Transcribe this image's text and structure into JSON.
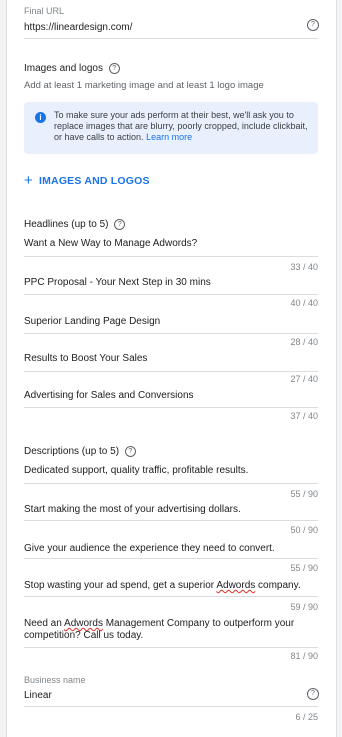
{
  "final_url": {
    "label": "Final URL",
    "value": "https://lineardesign.com/",
    "help": "?"
  },
  "images": {
    "title": "Images and logos",
    "help": "?",
    "subtitle": "Add at least 1 marketing image and at least 1 logo image",
    "info_icon": "i",
    "info_text": "To make sure your ads perform at their best, we'll ask you to replace images that are blurry, poorly cropped, include clickbait, or have calls to action. ",
    "info_link": "Learn more",
    "add_icon": "+",
    "add_label": "IMAGES AND LOGOS"
  },
  "headlines": {
    "title": "Headlines (up to 5)",
    "help": "?",
    "items": [
      {
        "text": "Want a New Way to Manage Adwords?",
        "counter": "33 / 40"
      },
      {
        "text": "PPC Proposal - Your Next Step in 30 mins",
        "counter": "40 / 40"
      },
      {
        "text": "Superior Landing Page Design",
        "counter": "28 / 40"
      },
      {
        "text": "Results to Boost Your Sales",
        "counter": "27 / 40"
      },
      {
        "text": "Advertising for Sales and Conversions",
        "counter": "37 / 40"
      }
    ]
  },
  "descriptions": {
    "title": "Descriptions (up to 5)",
    "help": "?",
    "items": [
      {
        "text": "Dedicated support, quality traffic, profitable results.",
        "counter": "55 / 90"
      },
      {
        "text": "Start making the most of your advertising dollars.",
        "counter": "50 / 90"
      },
      {
        "text": "Give your audience the experience they need to convert.",
        "counter": "55 / 90"
      },
      {
        "text_a": "Stop wasting your ad spend, get a superior ",
        "text_b": "Adwords",
        "text_c": " company.",
        "counter": "59 / 90"
      },
      {
        "line1_a": "Need an ",
        "line1_b": "Adwords",
        "line1_c": " Management Company to outperform your",
        "line2": "competition? Call us today.",
        "counter": "81 / 90"
      }
    ]
  },
  "business_name": {
    "label": "Business name",
    "value": "Linear",
    "help": "?",
    "counter": "6 / 25"
  }
}
